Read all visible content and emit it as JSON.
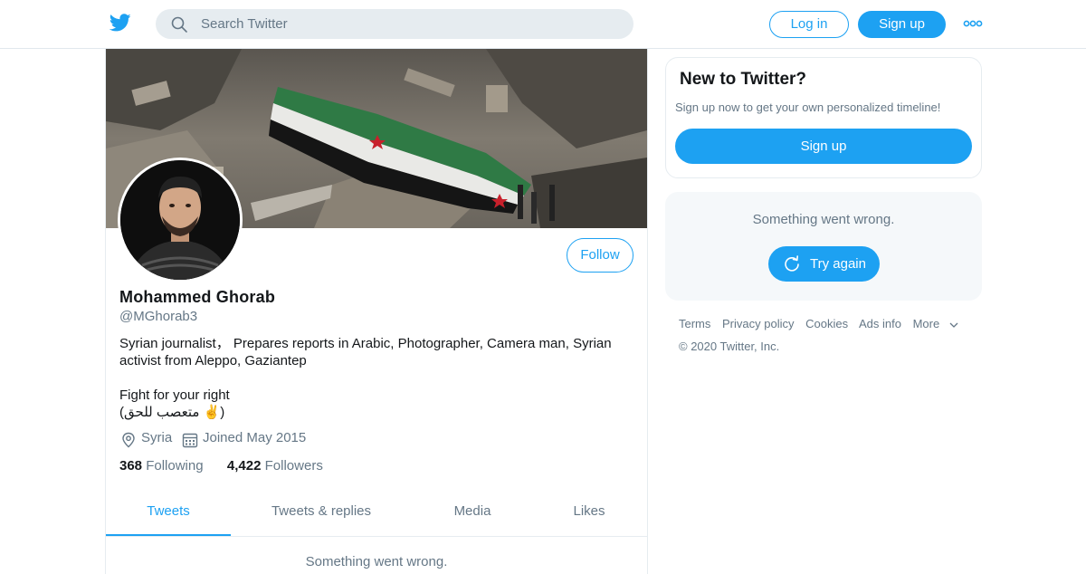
{
  "header": {
    "search_placeholder": "Search Twitter",
    "login_label": "Log in",
    "signup_label": "Sign up"
  },
  "profile": {
    "name": "Mohammed Ghorab",
    "handle": "@MGhorab3",
    "follow_label": "Follow",
    "bio_line1": "Syrian journalist， Prepares reports in Arabic, Photographer, Camera man, Syrian activist from Aleppo, Gaziantep",
    "bio_line2": "Fight for your right",
    "bio_line3": "(متعصب للحق ✌️)",
    "location": "Syria",
    "joined": "Joined May 2015",
    "following_count": "368",
    "following_label": "Following",
    "followers_count": "4,422",
    "followers_label": "Followers"
  },
  "tabs": [
    "Tweets",
    "Tweets & replies",
    "Media",
    "Likes"
  ],
  "timeline_error": "Something went wrong.",
  "sidebar": {
    "new_title": "New to Twitter?",
    "new_sub": "Sign up now to get your own personalized timeline!",
    "new_signup": "Sign up",
    "error_msg": "Something went wrong.",
    "try_again": "Try again"
  },
  "footer": {
    "links": [
      "Terms",
      "Privacy policy",
      "Cookies",
      "Ads info",
      "More"
    ],
    "copyright": "© 2020 Twitter, Inc."
  },
  "colors": {
    "accent": "#1da1f2",
    "secondary_text": "#657786",
    "border": "#e6ecf0"
  },
  "icons": [
    "twitter-bird-icon",
    "search-icon",
    "more-dots-icon",
    "location-pin-icon",
    "calendar-icon",
    "refresh-icon",
    "chevron-down-icon"
  ]
}
